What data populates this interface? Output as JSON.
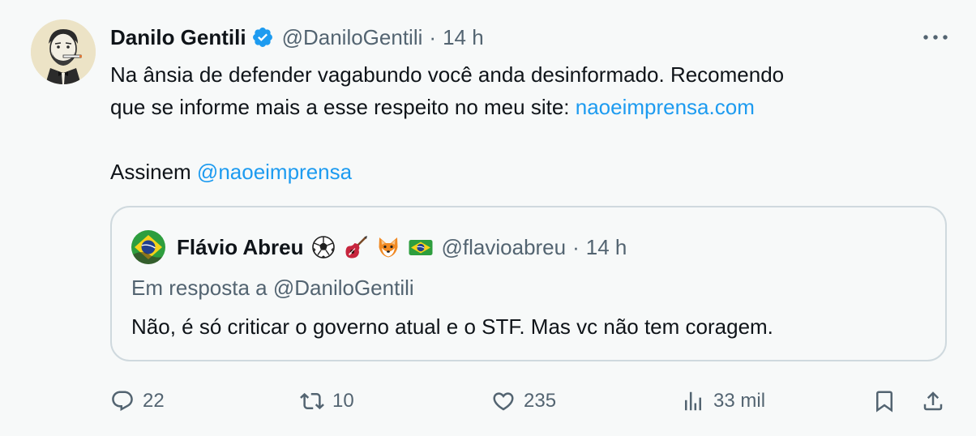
{
  "author": {
    "name": "Danilo Gentili",
    "handle": "@DaniloGentili",
    "separator": "·",
    "time": "14 h"
  },
  "tweet": {
    "line1": "Na ânsia de defender vagabundo você anda desinformado. Recomendo",
    "line2_prefix": "que se informe mais a esse respeito no meu site: ",
    "link": "naoeimprensa.com",
    "line3_prefix": "Assinem ",
    "mention": "@naoeimprensa"
  },
  "quote": {
    "name": "Flávio Abreu",
    "emojis": [
      "soccer-ball",
      "guitar",
      "fox",
      "brazil-flag"
    ],
    "handle": "@flavioabreu",
    "separator": "·",
    "time": "14 h",
    "reply_to": "Em resposta a @DaniloGentili",
    "text": "Não, é só criticar o governo atual e o STF. Mas vc não tem coragem."
  },
  "actions": {
    "replies": "22",
    "reposts": "10",
    "likes": "235",
    "views": "33 mil"
  },
  "colors": {
    "background": "#f7f9f9",
    "text": "#0f1419",
    "secondary": "#536471",
    "accent": "#1d9bf0",
    "border": "#cfd9de"
  }
}
